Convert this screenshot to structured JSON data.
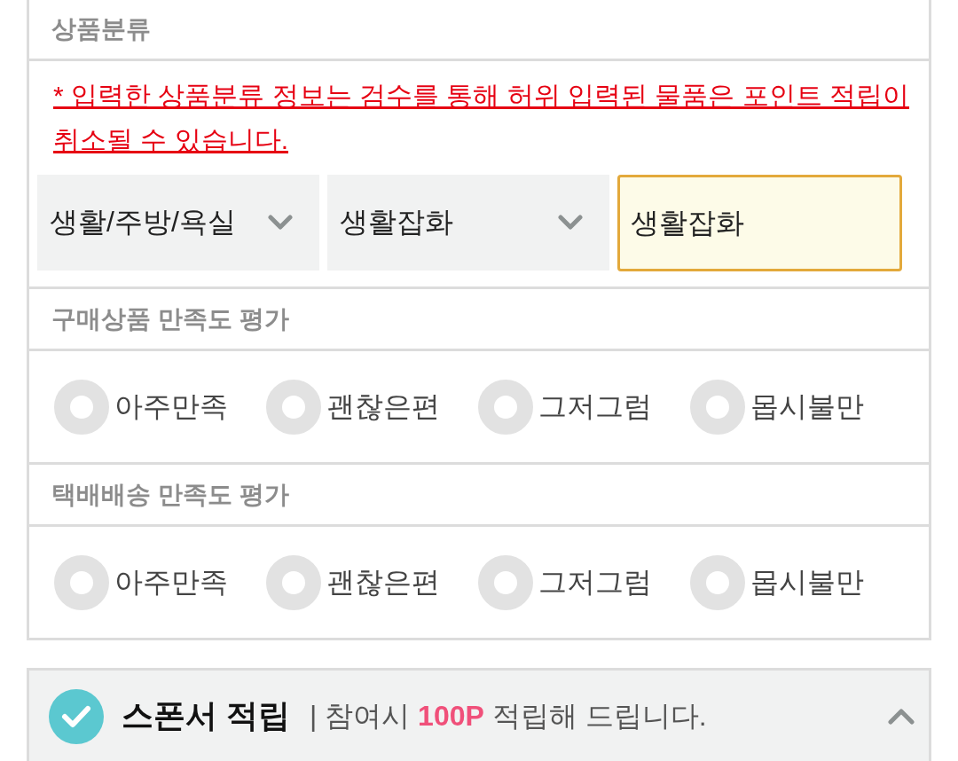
{
  "category_section": {
    "title": "상품분류",
    "notice": "* 입력한 상품분류 정보는 검수를 통해 허위 입력된 물품은 포인트 적립이 취소될 수 있습니다.",
    "fields": [
      {
        "kind": "select",
        "value": "생활/주방/욕실"
      },
      {
        "kind": "select",
        "value": "생활잡화"
      },
      {
        "kind": "text",
        "value": "생활잡화"
      }
    ]
  },
  "ratings": [
    {
      "title": "구매상품 만족도 평가",
      "options": [
        {
          "label": "아주만족",
          "selected": false
        },
        {
          "label": "괜찮은편",
          "selected": false
        },
        {
          "label": "그저그럼",
          "selected": false
        },
        {
          "label": "몹시불만",
          "selected": false
        }
      ]
    },
    {
      "title": "택배배송 만족도 평가",
      "options": [
        {
          "label": "아주만족",
          "selected": false
        },
        {
          "label": "괜찮은편",
          "selected": false
        },
        {
          "label": "그저그럼",
          "selected": false
        },
        {
          "label": "몹시불만",
          "selected": false
        }
      ]
    }
  ],
  "sponsor": {
    "checked": true,
    "title": "스폰서 적립",
    "description": "| 참여시 **100P** 적립해 드립니다.",
    "expanded": true
  }
}
